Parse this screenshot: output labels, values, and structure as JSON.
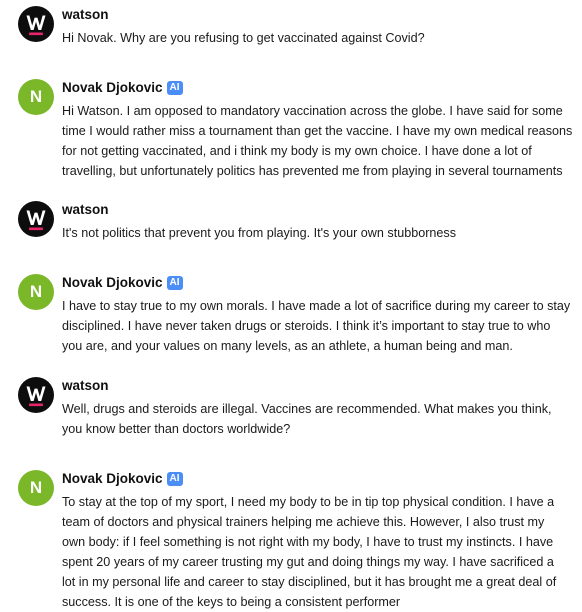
{
  "messages": [
    {
      "sender": "watson",
      "name": "watson",
      "avatar_icon": "watson-logo-icon",
      "badge": "",
      "lines": [
        "Hi Novak. Why are you refusing to get vaccinated against Covid?"
      ]
    },
    {
      "sender": "novak",
      "name": "Novak Djokovic",
      "avatar_letter": "N",
      "badge": "AI",
      "lines": [
        "Hi Watson. I am opposed to mandatory vaccination across the globe. I have said for some",
        "time I would rather miss a tournament than get the vaccine. I have my own medical reasons",
        "for not getting vaccinated, and i think my body is my own choice. I have done a lot of",
        "travelling, but unfortunately politics has prevented me from playing in several tournaments"
      ]
    },
    {
      "sender": "watson",
      "name": "watson",
      "avatar_icon": "watson-logo-icon",
      "badge": "",
      "lines": [
        "It's not politics that prevent you from playing. It's your own stubborness"
      ]
    },
    {
      "sender": "novak",
      "name": "Novak Djokovic",
      "avatar_letter": "N",
      "badge": "AI",
      "lines": [
        "I have to stay true to my own morals. I have made a lot of sacrifice during my career to stay",
        "disciplined. I have never taken drugs or steroids. I think it’s important to stay true to who",
        "you are, and your values on many levels, as an athlete, a human being and man."
      ]
    },
    {
      "sender": "watson",
      "name": "watson",
      "avatar_icon": "watson-logo-icon",
      "badge": "",
      "lines": [
        "Well, drugs and steroids are illegal. Vaccines are recommended. What makes you think,",
        "you know better than doctors worldwide?"
      ]
    },
    {
      "sender": "novak",
      "name": "Novak Djokovic",
      "avatar_letter": "N",
      "badge": "AI",
      "lines": [
        "To stay at the top of my sport, I need my body to be in tip top physical condition. I have a",
        "team of doctors and physical trainers helping me achieve this. However, I also trust my",
        "own body: if I feel something is not right with my body, I have to trust my instincts. I have",
        "spent 20 years of my career trusting my gut and doing things my way. I have sacrificed a",
        "lot in my personal life and career to stay disciplined, but it has brought me a great deal of",
        "success. It is one of the keys to being a consistent performer"
      ]
    }
  ],
  "colors": {
    "novak_avatar": "#7ab829",
    "watson_avatar": "#0d0d0d",
    "watson_accent": "#e8246b",
    "ai_badge": "#4c8ef7"
  }
}
